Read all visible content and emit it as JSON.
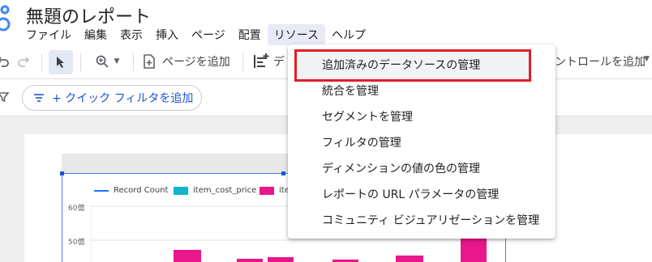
{
  "app": {
    "doc_title": "無題のレポート"
  },
  "menubar": {
    "items": [
      "ファイル",
      "編集",
      "表示",
      "挿入",
      "ページ",
      "配置",
      "リソース",
      "ヘルプ"
    ],
    "active_index": 6
  },
  "toolbar": {
    "add_page_label": "ページを追加",
    "add_data_label": "デ",
    "add_control_label": "ントロールを追加"
  },
  "filter_bar": {
    "quick_filter_label": "+ クイック フィルタを追加"
  },
  "chart": {
    "legend": [
      {
        "label": "Record Count",
        "color": "#1a73e8"
      },
      {
        "label": "item_cost_price",
        "color": "#12b5cb"
      },
      {
        "label": "ite",
        "color": "#e8178a"
      }
    ],
    "y_ticks": [
      "60億",
      "50億"
    ]
  },
  "resource_menu": {
    "items": [
      "追加済みのデータソースの管理",
      "統合を管理",
      "セグメントを管理",
      "フィルタの管理",
      "ディメンションの値の色の管理",
      "レポートの URL パラメータの管理",
      "コミュニティ ビジュアリゼーションを管理"
    ],
    "highlighted_index": 0
  },
  "colors": {
    "accent": "#1a55d0",
    "highlight_border": "#e31e25",
    "bar_pink": "#e8178a"
  }
}
